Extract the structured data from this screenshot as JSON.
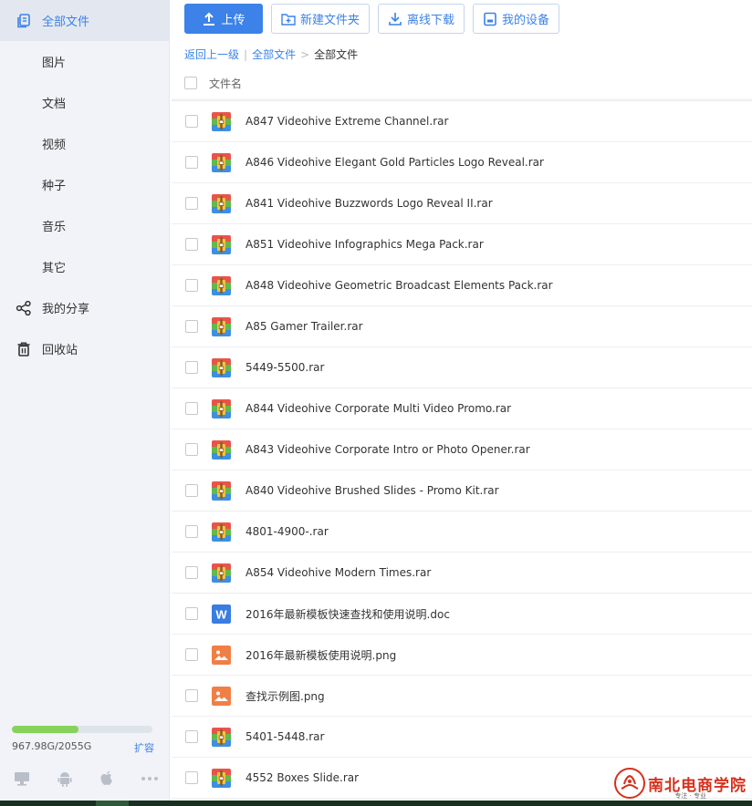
{
  "sidebar": {
    "items": [
      {
        "label": "全部文件",
        "icon": "files-icon",
        "active": true
      },
      {
        "label": "图片"
      },
      {
        "label": "文档"
      },
      {
        "label": "视频"
      },
      {
        "label": "种子"
      },
      {
        "label": "音乐"
      },
      {
        "label": "其它"
      },
      {
        "label": "我的分享",
        "icon": "share-icon"
      },
      {
        "label": "回收站",
        "icon": "trash-icon"
      }
    ],
    "storage": {
      "used_label": "967.98G/2055G",
      "used_fraction": 0.471,
      "expand_label": "扩容"
    },
    "devices": [
      "desktop-icon",
      "android-icon",
      "apple-icon",
      "more-icon"
    ]
  },
  "toolbar": {
    "upload_label": "上传",
    "new_folder_label": "新建文件夹",
    "offline_download_label": "离线下载",
    "my_devices_label": "我的设备"
  },
  "breadcrumb": {
    "back_label": "返回上一级",
    "root_label": "全部文件",
    "current_label": "全部文件"
  },
  "list": {
    "column_name": "文件名",
    "files": [
      {
        "name": "A847 Videohive Extreme Channel.rar",
        "type": "rar"
      },
      {
        "name": "A846 Videohive Elegant Gold Particles Logo Reveal.rar",
        "type": "rar"
      },
      {
        "name": "A841 Videohive Buzzwords Logo Reveal II.rar",
        "type": "rar"
      },
      {
        "name": "A851 Videohive Infographics Mega Pack.rar",
        "type": "rar"
      },
      {
        "name": "A848 Videohive Geometric Broadcast Elements Pack.rar",
        "type": "rar"
      },
      {
        "name": "A85 Gamer Trailer.rar",
        "type": "rar"
      },
      {
        "name": "5449-5500.rar",
        "type": "rar"
      },
      {
        "name": "A844 Videohive Corporate Multi Video Promo.rar",
        "type": "rar"
      },
      {
        "name": "A843 Videohive Corporate Intro or Photo Opener.rar",
        "type": "rar"
      },
      {
        "name": "A840 Videohive Brushed Slides - Promo Kit.rar",
        "type": "rar"
      },
      {
        "name": "4801-4900-.rar",
        "type": "rar"
      },
      {
        "name": "A854 Videohive Modern Times.rar",
        "type": "rar"
      },
      {
        "name": "2016年最新模板快速查找和使用说明.doc",
        "type": "doc"
      },
      {
        "name": "2016年最新模板使用说明.png",
        "type": "png"
      },
      {
        "name": "查找示例图.png",
        "type": "png"
      },
      {
        "name": "5401-5448.rar",
        "type": "rar"
      },
      {
        "name": "4552 Boxes Slide.rar",
        "type": "rar"
      }
    ]
  },
  "watermark": {
    "text": "南北电商学院",
    "sub": "专注 · 专业"
  },
  "colors": {
    "accent": "#3c82e8",
    "storage_fill": "#86d25b",
    "png_icon": "#f07f45",
    "doc_icon": "#3a7de1",
    "watermark": "#d6311d"
  }
}
